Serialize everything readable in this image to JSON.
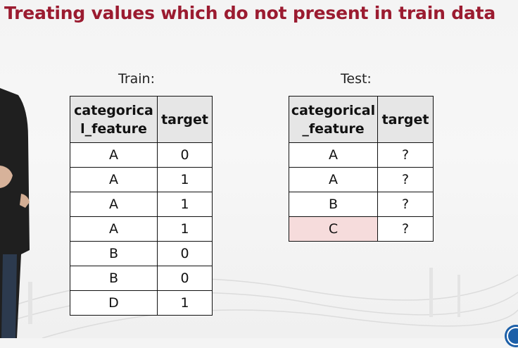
{
  "slide": {
    "title": "Treating values which do not present in train data"
  },
  "train": {
    "label": "Train:",
    "headers": {
      "col1_line1": "categorica",
      "col1_line2": "l_feature",
      "col2": "target"
    },
    "rows": [
      {
        "feature": "A",
        "target": "0"
      },
      {
        "feature": "A",
        "target": "1"
      },
      {
        "feature": "A",
        "target": "1"
      },
      {
        "feature": "A",
        "target": "1"
      },
      {
        "feature": "B",
        "target": "0"
      },
      {
        "feature": "B",
        "target": "0"
      },
      {
        "feature": "D",
        "target": "1"
      }
    ]
  },
  "test": {
    "label": "Test:",
    "headers": {
      "col1_line1": "categorical",
      "col1_line2": "_feature",
      "col2": "target"
    },
    "rows": [
      {
        "feature": "A",
        "target": "?"
      },
      {
        "feature": "A",
        "target": "?"
      },
      {
        "feature": "B",
        "target": "?"
      },
      {
        "feature": "C",
        "target": "?",
        "highlighted": true
      }
    ]
  },
  "colors": {
    "title": "#9b1b30",
    "header_bg": "#e6e6e6",
    "highlight": "#f6dcdc"
  },
  "icons": [
    "presenter-figure",
    "corner-logo-icon"
  ]
}
